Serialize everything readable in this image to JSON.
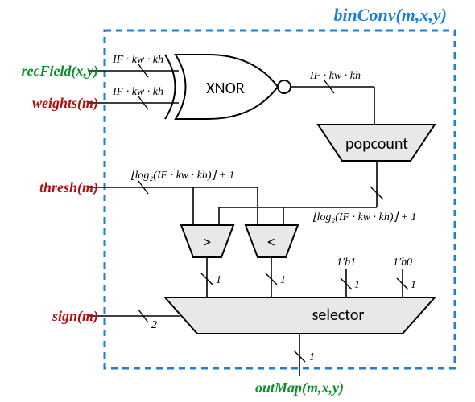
{
  "title": "binConv(m,x,y)",
  "ports": {
    "recField": "recField(x,y)",
    "weights": "weights(m)",
    "thresh": "thresh(m)",
    "sign": "sign(m)",
    "outMap": "outMap(m,x,y)"
  },
  "labels": {
    "ifw": "IF · kw · kh",
    "log2": "⌊log₂(IF · kw · kh)⌋ + 1",
    "one": "1",
    "two": "2",
    "b1": "1′b1",
    "b0": "1′b0"
  },
  "blocks": {
    "xnor": "XNOR",
    "popcount": "popcount",
    "gt": ">",
    "lt": "<",
    "selector": "selector"
  }
}
